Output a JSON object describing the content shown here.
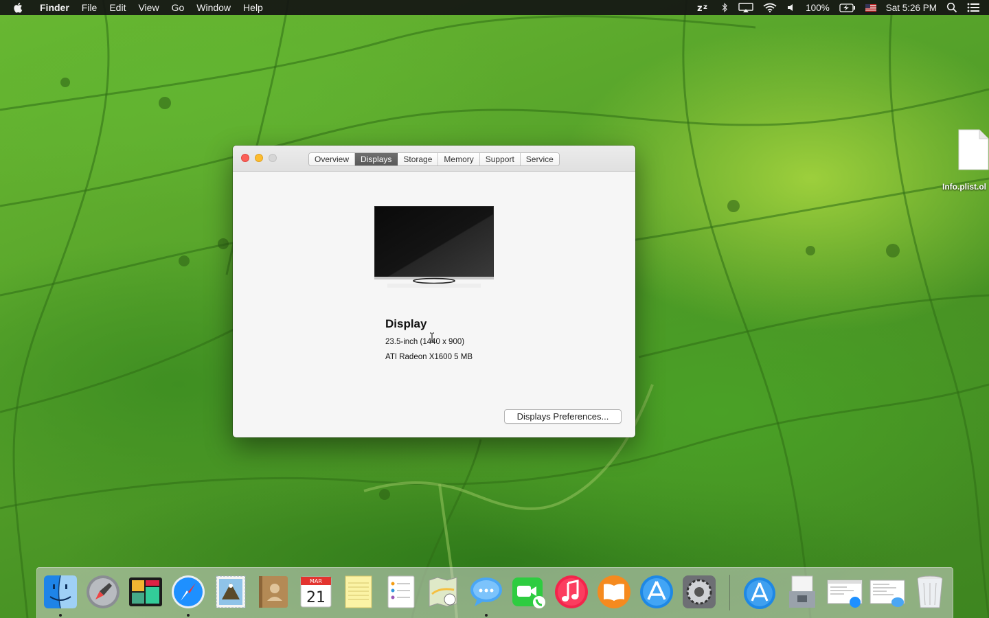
{
  "menubar": {
    "app_name": "Finder",
    "menus": [
      "File",
      "Edit",
      "View",
      "Go",
      "Window",
      "Help"
    ],
    "battery": "100%",
    "clock": "Sat 5:26 PM",
    "status_icons": [
      "sleep-icon",
      "bluetooth-icon",
      "airplay-icon",
      "wifi-icon",
      "volume-icon",
      "battery-icon",
      "flag-icon",
      "spotlight-icon",
      "notification-center-icon"
    ]
  },
  "desktop": {
    "file_name": "Info.plist.ol"
  },
  "window": {
    "tabs": [
      {
        "label": "Overview",
        "active": false
      },
      {
        "label": "Displays",
        "active": true
      },
      {
        "label": "Storage",
        "active": false
      },
      {
        "label": "Memory",
        "active": false
      },
      {
        "label": "Support",
        "active": false
      },
      {
        "label": "Service",
        "active": false
      }
    ],
    "display": {
      "title": "Display",
      "size": "23.5-inch (1440 x 900)",
      "graphics": "ATI Radeon X1600 5 MB"
    },
    "prefs_button": "Displays Preferences..."
  },
  "dock": {
    "apps": [
      {
        "name": "Finder",
        "icon": "finder-icon",
        "running": true
      },
      {
        "name": "Launchpad",
        "icon": "launchpad-icon",
        "running": false
      },
      {
        "name": "Activity Monitor",
        "icon": "activity-monitor-icon",
        "running": false
      },
      {
        "name": "Safari",
        "icon": "safari-icon",
        "running": true
      },
      {
        "name": "Mail",
        "icon": "mail-icon",
        "running": false
      },
      {
        "name": "Contacts",
        "icon": "contacts-icon",
        "running": false
      },
      {
        "name": "Calendar",
        "icon": "calendar-icon",
        "running": false,
        "month": "MAR",
        "day": "21"
      },
      {
        "name": "Notes",
        "icon": "notes-icon",
        "running": false
      },
      {
        "name": "Reminders",
        "icon": "reminders-icon",
        "running": false
      },
      {
        "name": "Maps",
        "icon": "maps-icon",
        "running": false
      },
      {
        "name": "Messages",
        "icon": "messages-icon",
        "running": true
      },
      {
        "name": "FaceTime",
        "icon": "facetime-icon",
        "running": false
      },
      {
        "name": "iTunes",
        "icon": "itunes-icon",
        "running": false
      },
      {
        "name": "iBooks",
        "icon": "ibooks-icon",
        "running": false
      },
      {
        "name": "App Store",
        "icon": "app-store-icon",
        "running": false
      },
      {
        "name": "System Preferences",
        "icon": "system-preferences-icon",
        "running": false
      }
    ],
    "stacks": [
      {
        "name": "Applications",
        "icon": "applications-folder-icon"
      },
      {
        "name": "Archive",
        "icon": "archive-utility-icon"
      },
      {
        "name": "Safari Document",
        "icon": "safari-document-icon"
      },
      {
        "name": "Messages Document",
        "icon": "messages-document-icon"
      },
      {
        "name": "Trash",
        "icon": "trash-icon"
      }
    ]
  }
}
